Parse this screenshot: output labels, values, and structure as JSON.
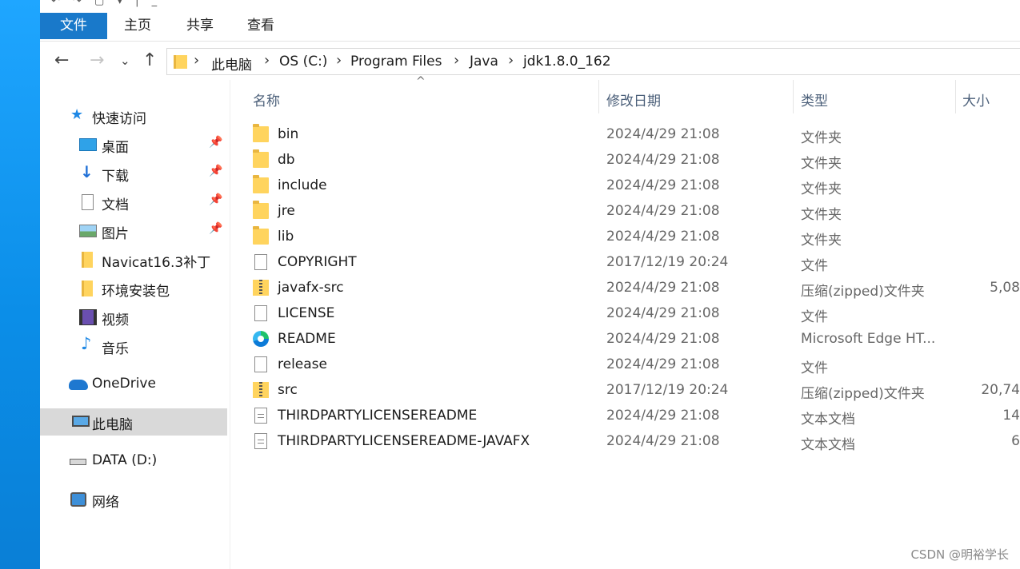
{
  "titlebar": {
    "qat_glyphs": "↶ ↷ ▢ ▾ | _"
  },
  "ribbon": {
    "tabs": [
      "文件",
      "主页",
      "共享",
      "查看"
    ]
  },
  "nav": {
    "back": "←",
    "forward": "→",
    "recent": "⌄",
    "up": "↑"
  },
  "address": {
    "crumbs": [
      "此电脑",
      "OS (C:)",
      "Program Files",
      "Java",
      "jdk1.8.0_162"
    ],
    "separator": "›"
  },
  "sidebar": {
    "quick_access": "快速访问",
    "quick_items": [
      {
        "label": "桌面",
        "icon": "desktop-icon",
        "pinned": true
      },
      {
        "label": "下载",
        "icon": "download-icon",
        "pinned": true
      },
      {
        "label": "文档",
        "icon": "documents-icon",
        "pinned": true
      },
      {
        "label": "图片",
        "icon": "pictures-icon",
        "pinned": true
      },
      {
        "label": "Navicat16.3补丁",
        "icon": "folder-icon",
        "pinned": false
      },
      {
        "label": "环境安装包",
        "icon": "folder-icon",
        "pinned": false
      },
      {
        "label": "视频",
        "icon": "video-icon",
        "pinned": false
      },
      {
        "label": "音乐",
        "icon": "music-icon",
        "pinned": false
      }
    ],
    "onedrive": "OneDrive",
    "this_pc": "此电脑",
    "data_drive": "DATA (D:)",
    "network": "网络",
    "pin_glyph": "📌"
  },
  "columns": {
    "name": "名称",
    "date": "修改日期",
    "type": "类型",
    "size": "大小",
    "sort_glyph": "^"
  },
  "files": [
    {
      "name": "bin",
      "date": "2024/4/29 21:08",
      "type": "文件夹",
      "size": "",
      "icon": "folder-icon"
    },
    {
      "name": "db",
      "date": "2024/4/29 21:08",
      "type": "文件夹",
      "size": "",
      "icon": "folder-icon"
    },
    {
      "name": "include",
      "date": "2024/4/29 21:08",
      "type": "文件夹",
      "size": "",
      "icon": "folder-icon"
    },
    {
      "name": "jre",
      "date": "2024/4/29 21:08",
      "type": "文件夹",
      "size": "",
      "icon": "folder-icon"
    },
    {
      "name": "lib",
      "date": "2024/4/29 21:08",
      "type": "文件夹",
      "size": "",
      "icon": "folder-icon"
    },
    {
      "name": "COPYRIGHT",
      "date": "2017/12/19 20:24",
      "type": "文件",
      "size": "",
      "icon": "file-icon"
    },
    {
      "name": "javafx-src",
      "date": "2024/4/29 21:08",
      "type": "压缩(zipped)文件夹",
      "size": "5,08",
      "icon": "zip-icon"
    },
    {
      "name": "LICENSE",
      "date": "2024/4/29 21:08",
      "type": "文件",
      "size": "",
      "icon": "file-icon"
    },
    {
      "name": "README",
      "date": "2024/4/29 21:08",
      "type": "Microsoft Edge HT...",
      "size": "",
      "icon": "edge-icon"
    },
    {
      "name": "release",
      "date": "2024/4/29 21:08",
      "type": "文件",
      "size": "",
      "icon": "file-icon"
    },
    {
      "name": "src",
      "date": "2017/12/19 20:24",
      "type": "压缩(zipped)文件夹",
      "size": "20,74",
      "icon": "zip-icon"
    },
    {
      "name": "THIRDPARTYLICENSEREADME",
      "date": "2024/4/29 21:08",
      "type": "文本文档",
      "size": "14",
      "icon": "text-file-icon"
    },
    {
      "name": "THIRDPARTYLICENSEREADME-JAVAFX",
      "date": "2024/4/29 21:08",
      "type": "文本文档",
      "size": "6",
      "icon": "text-file-icon"
    }
  ],
  "watermark": "CSDN @明裕学长",
  "colors": {
    "accent": "#1979ca",
    "desktop": "#0a8be0",
    "selected": "#d9d9d9"
  }
}
